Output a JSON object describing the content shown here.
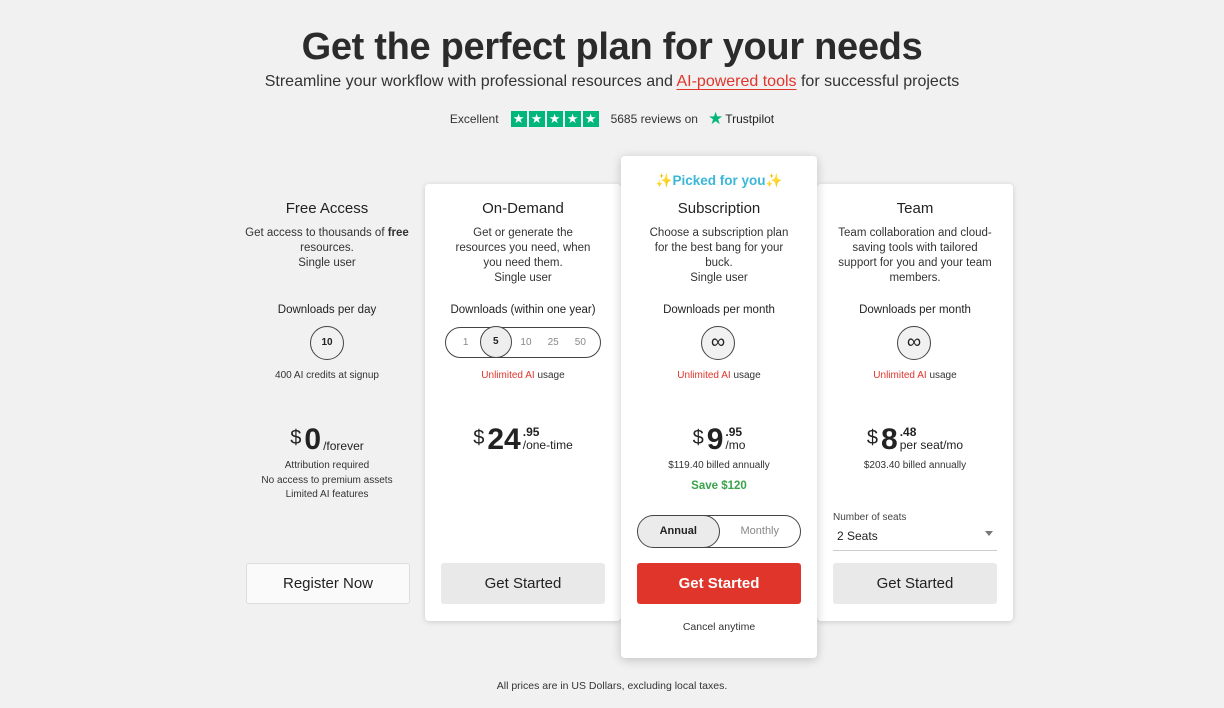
{
  "header": {
    "title": "Get the perfect plan for your needs",
    "subtitle_pre": "Streamline your workflow with professional resources and",
    "subtitle_link": "AI-powered tools",
    "subtitle_post": "for successful projects"
  },
  "trust": {
    "rating_label": "Excellent",
    "stars": 5,
    "reviews": "5685 reviews on",
    "brand": "Trustpilot"
  },
  "colors": {
    "accent": "#e0352b",
    "trustpilot": "#00b67a",
    "save": "#3aa34b",
    "picked": "#3bb7d8"
  },
  "plans": {
    "free": {
      "name": "Free Access",
      "desc_pre": "Get access to thousands of",
      "desc_bold": "free",
      "desc_post": "resources.",
      "desc_user": "Single user",
      "downloads_label": "Downloads per day",
      "downloads_value": "10",
      "note": "400 AI credits at signup",
      "currency": "$",
      "price": "0",
      "period": "/forever",
      "lines": [
        "Attribution required",
        "No access to premium assets",
        "Limited AI features"
      ],
      "button": "Register Now"
    },
    "ondemand": {
      "name": "On-Demand",
      "desc": "Get or generate the resources you need, when you need them.",
      "desc_user": "Single user",
      "downloads_label": "Downloads (within one year)",
      "options": [
        "1",
        "5",
        "10",
        "25",
        "50"
      ],
      "selected_option": "5",
      "note_red": "Unlimited AI",
      "note_rest": "usage",
      "currency": "$",
      "price": "24",
      "cents": ".95",
      "period": "/one-time",
      "button": "Get Started"
    },
    "subscription": {
      "badge": "✨Picked for you✨",
      "name": "Subscription",
      "desc": "Choose a subscription plan for the best bang for your buck.",
      "desc_user": "Single user",
      "downloads_label": "Downloads per month",
      "downloads_value": "∞",
      "note_red": "Unlimited AI",
      "note_rest": "usage",
      "currency": "$",
      "price": "9",
      "cents": ".95",
      "period": "/mo",
      "billed": "$119.40 billed annually",
      "save": "Save $120",
      "toggle": [
        "Annual",
        "Monthly"
      ],
      "toggle_selected": "Annual",
      "button": "Get Started",
      "cancel": "Cancel anytime"
    },
    "team": {
      "name": "Team",
      "desc": "Team collaboration and cloud-saving tools with tailored support for you and your team members.",
      "downloads_label": "Downloads per month",
      "downloads_value": "∞",
      "note_red": "Unlimited AI",
      "note_rest": "usage",
      "currency": "$",
      "price": "8",
      "cents": ".48",
      "period": "per seat/mo",
      "billed": "$203.40 billed annually",
      "seats_label": "Number of seats",
      "seats_value": "2 Seats",
      "button": "Get Started"
    }
  },
  "footer": "All prices are in US Dollars, excluding local taxes."
}
